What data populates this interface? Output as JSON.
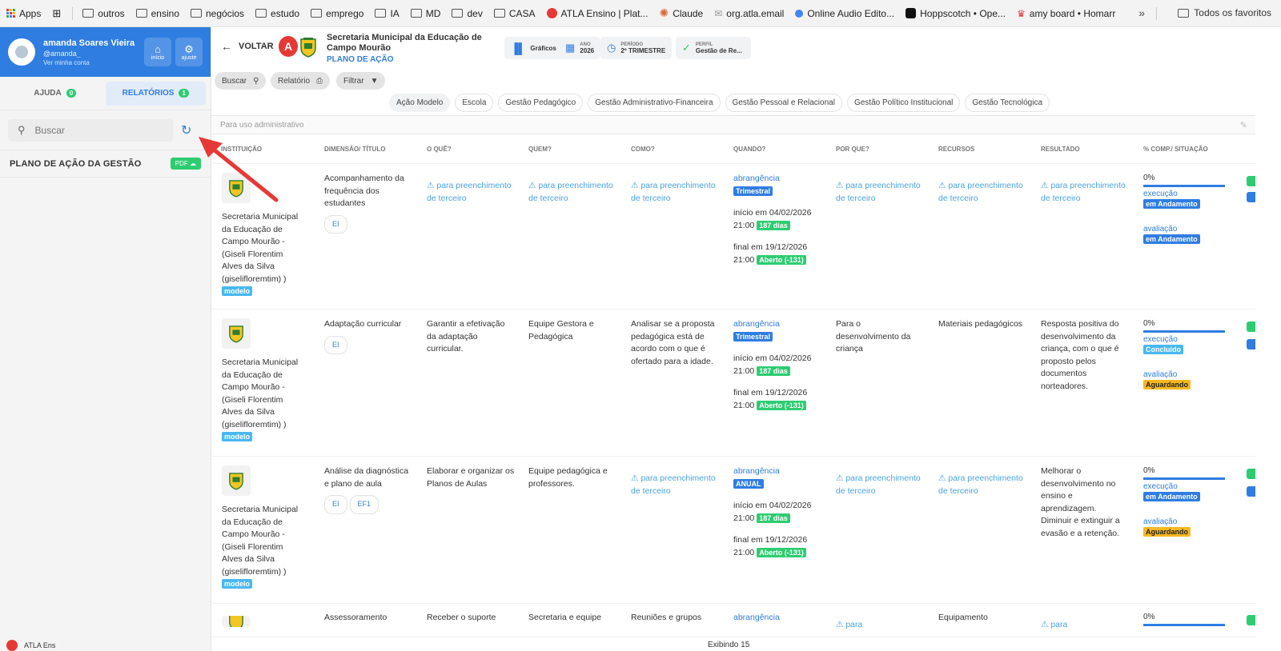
{
  "bookmarks": [
    {
      "label": "Apps",
      "icon": "apps-grid-icon"
    },
    {
      "label": "",
      "icon": "tab-grid-icon"
    },
    {
      "label": "outros",
      "icon": "folder-icon"
    },
    {
      "label": "ensino",
      "icon": "folder-icon"
    },
    {
      "label": "negócios",
      "icon": "folder-icon"
    },
    {
      "label": "estudo",
      "icon": "folder-icon"
    },
    {
      "label": "emprego",
      "icon": "folder-icon"
    },
    {
      "label": "IA",
      "icon": "folder-icon"
    },
    {
      "label": "MD",
      "icon": "folder-icon"
    },
    {
      "label": "dev",
      "icon": "folder-icon"
    },
    {
      "label": "CASA",
      "icon": "folder-icon"
    },
    {
      "label": "ATLA Ensino | Plat...",
      "icon": "atla-icon"
    },
    {
      "label": "Claude",
      "icon": "claude-icon"
    },
    {
      "label": "org.atla.email",
      "icon": "mail-icon"
    },
    {
      "label": "Online Audio Edito...",
      "icon": "audio-icon"
    },
    {
      "label": "Hoppscotch • Ope...",
      "icon": "hoppscotch-icon"
    },
    {
      "label": "amy board • Homarr",
      "icon": "homarr-icon"
    }
  ],
  "bookmarks_more": "»",
  "bookmarks_all": "Todos os favoritos",
  "user": {
    "name": "amanda Soares Vieira",
    "handle": "@amanda_",
    "link": "Ver minha conta",
    "home_label": "início",
    "settings_label": "ajuste"
  },
  "side_tabs": [
    {
      "label": "AJUDA",
      "count": "0"
    },
    {
      "label": "RELATÓRIOS",
      "count": "1"
    }
  ],
  "side_search_placeholder": "Buscar",
  "plano_title": "PLANO DE AÇÃO DA GESTÃO",
  "pdf_label": "PDF",
  "side_footer": "ATLA Ens",
  "header": {
    "back": "VOLTAR",
    "title": "Secretaria Municipal da Educação de Campo Mourão",
    "subtitle": "PLANO DE AÇÃO",
    "graficos": "Gráficos",
    "ano_label": "ANO",
    "ano_value": "2026",
    "periodo_label": "PERÍODO",
    "periodo_value": "2º TRIMESTRE",
    "perfil_label": "PERFIL",
    "perfil_value": "Gestão de Re..."
  },
  "toolbar": {
    "buscar": "Buscar",
    "relatorio": "Relatório",
    "filtrar": "Filtrar"
  },
  "chips": [
    "Ação Modelo",
    "Escola",
    "Gestão Pedagógico",
    "Gestão Administrativo-Financeira",
    "Gestão Pessoal e Relacional",
    "Gestão Político Institucional",
    "Gestão Tecnológica"
  ],
  "admin_placeholder": "Para uso administrativo",
  "columns": [
    "INSTITUIÇÃO",
    "DIMENSÃO/ TÍTULO",
    "O QUÊ?",
    "QUEM?",
    "COMO?",
    "QUANDO?",
    "POR QUE?",
    "RECURSOS",
    "RESULTADO",
    "% COMP./ SITUAÇÃO"
  ],
  "rows": [
    {
      "institution": "Secretaria Municipal da Educação de Campo Mourão - (Giseli Florentim Alves da Silva (giselifloremtim) )",
      "inst_tag": "modelo",
      "dimension": "Acompanhamento da frequência dos estudantes",
      "pills": [
        "EI"
      ],
      "oque": "⚠ para preenchimento de terceiro",
      "quem": "⚠ para preenchimento de terceiro",
      "como": "⚠ para preenchimento de terceiro",
      "abrangencia": "abrangência",
      "freq": "Trimestral",
      "inicio": "início em 04/02/2026",
      "inicio_hora": "21:00",
      "dias": "187 dias",
      "final": "final em 19/12/2026",
      "final_hora": "21:00",
      "aberto": "Aberto (-131)",
      "porque": "⚠ para preenchimento de terceiro",
      "recursos": "⚠ para preenchimento de terceiro",
      "resultado": "⚠ para preenchimento de terceiro",
      "pct": "0%",
      "execucao": "execução",
      "exec_status": "em Andamento",
      "avaliacao": "avaliação",
      "aval_status": "em Andamento"
    },
    {
      "institution": "Secretaria Municipal da Educação de Campo Mourão - (Giseli Florentim Alves da Silva (giselifloremtim) )",
      "inst_tag": "modelo",
      "dimension": "Adaptação curricular",
      "pills": [
        "EI"
      ],
      "oque": "Garantir a efetivação da adaptação curricular.",
      "quem": "Equipe Gestora e Pedagógica",
      "como": "Analisar se a proposta pedagógica está de acordo com o que é ofertado para a idade.",
      "abrangencia": "abrangência",
      "freq": "Trimestral",
      "inicio": "início em 04/02/2026",
      "inicio_hora": "21:00",
      "dias": "187 dias",
      "final": "final em 19/12/2026",
      "final_hora": "21:00",
      "aberto": "Aberto (-131)",
      "porque": "Para o desenvolvimento da criança",
      "recursos": "Materiais pedagógicos",
      "resultado": "Resposta positiva do desenvolvimento da criança, com o que é proposto pelos documentos norteadores.",
      "pct": "0%",
      "execucao": "execução",
      "exec_status": "Concluído",
      "avaliacao": "avaliação",
      "aval_status": "Aguardando"
    },
    {
      "institution": "Secretaria Municipal da Educação de Campo Mourão - (Giseli Florentim Alves da Silva (giselifloremtim) )",
      "inst_tag": "modelo",
      "dimension": "Análise da diagnóstica e plano de aula",
      "pills": [
        "EI",
        "EF1"
      ],
      "oque": "Elaborar e organizar os Planos de Aulas",
      "quem": "Equipe pedagógica e professores.",
      "como": "⚠ para preenchimento de terceiro",
      "abrangencia": "abrangência",
      "freq": "ANUAL",
      "inicio": "início em 04/02/2026",
      "inicio_hora": "21:00",
      "dias": "187 dias",
      "final": "final em 19/12/2026",
      "final_hora": "21:00",
      "aberto": "Aberto (-131)",
      "porque": "⚠ para preenchimento de terceiro",
      "recursos": "⚠ para preenchimento de terceiro",
      "resultado": "Melhorar o desenvolvimento no ensino e aprendizagem. Diminuir e extinguir a evasão e a retenção.",
      "pct": "0%",
      "execucao": "execução",
      "exec_status": "em Andamento",
      "avaliacao": "avaliação",
      "aval_status": "Aguardando"
    },
    {
      "dimension": "Assessoramento",
      "oque": "Receber o suporte",
      "quem": "Secretaria e equipe",
      "como": "Reuniões e grupos",
      "abrangencia": "abrangência",
      "porque": "⚠ para",
      "recursos": "Equipamento",
      "resultado": "⚠ para",
      "pct": "0%"
    }
  ],
  "footer": "Exibindo 15"
}
